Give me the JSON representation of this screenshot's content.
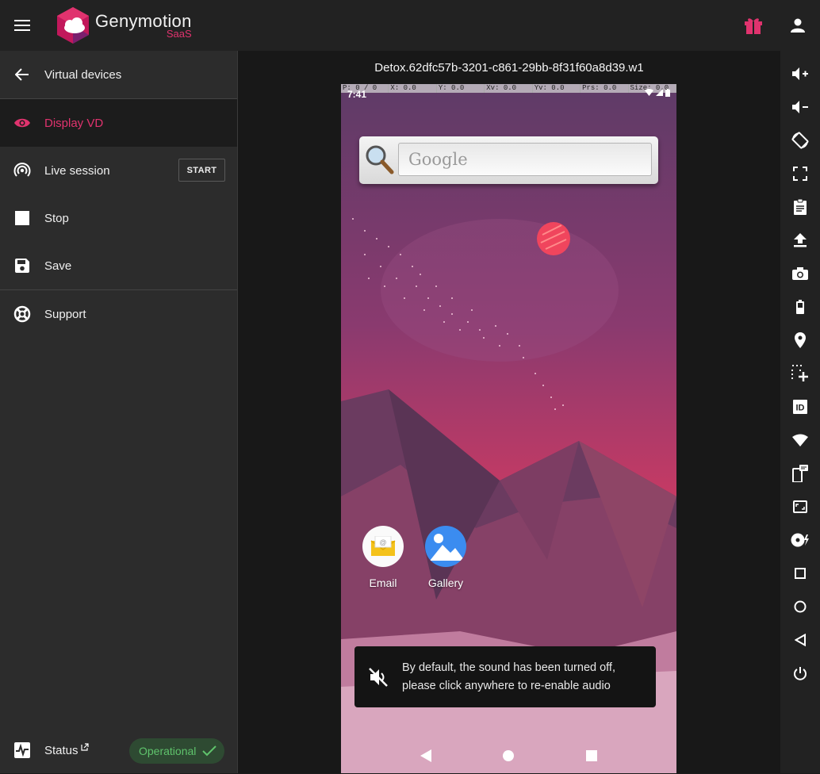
{
  "header": {
    "brand_name": "Genymotion",
    "brand_sub": "SaaS"
  },
  "sidebar": {
    "back_label": "Virtual devices",
    "items": [
      {
        "label": "Display VD",
        "icon": "eye-icon",
        "active": true
      },
      {
        "label": "Live session",
        "icon": "broadcast-icon",
        "button": "START"
      },
      {
        "label": "Stop",
        "icon": "stop-icon"
      },
      {
        "label": "Save",
        "icon": "save-icon"
      }
    ],
    "support_label": "Support",
    "status_label": "Status",
    "status_value": "Operational"
  },
  "device": {
    "title": "Detox.62dfc57b-3201-c861-29bb-8f31f60a8d39.w1",
    "debug_bar": [
      "P: 0 / 0",
      "X: 0.0",
      "Y: 0.0",
      "Xv: 0.0",
      "Yv: 0.0",
      "Prs: 0.0",
      "Size: 0.0"
    ],
    "time": "7:41",
    "search_placeholder": "Google",
    "apps": [
      {
        "name": "Email"
      },
      {
        "name": "Gallery"
      }
    ],
    "toast_line1": "By default, the sound has been turned off,",
    "toast_line2": "please click anywhere to re-enable audio"
  },
  "toolbar_icons": [
    "volume-up-icon",
    "volume-down-icon",
    "rotate-icon",
    "fullscreen-icon",
    "clipboard-icon",
    "upload-icon",
    "camera-icon",
    "battery-icon",
    "location-icon",
    "multitouch-icon",
    "identifiers-icon",
    "wifi-icon",
    "phone-sms-icon",
    "resize-icon",
    "disk-io-icon",
    "recent-apps-icon",
    "home-icon",
    "back-icon",
    "power-icon"
  ],
  "colors": {
    "accent": "#e0336e",
    "status_ok": "#5fc36c"
  }
}
